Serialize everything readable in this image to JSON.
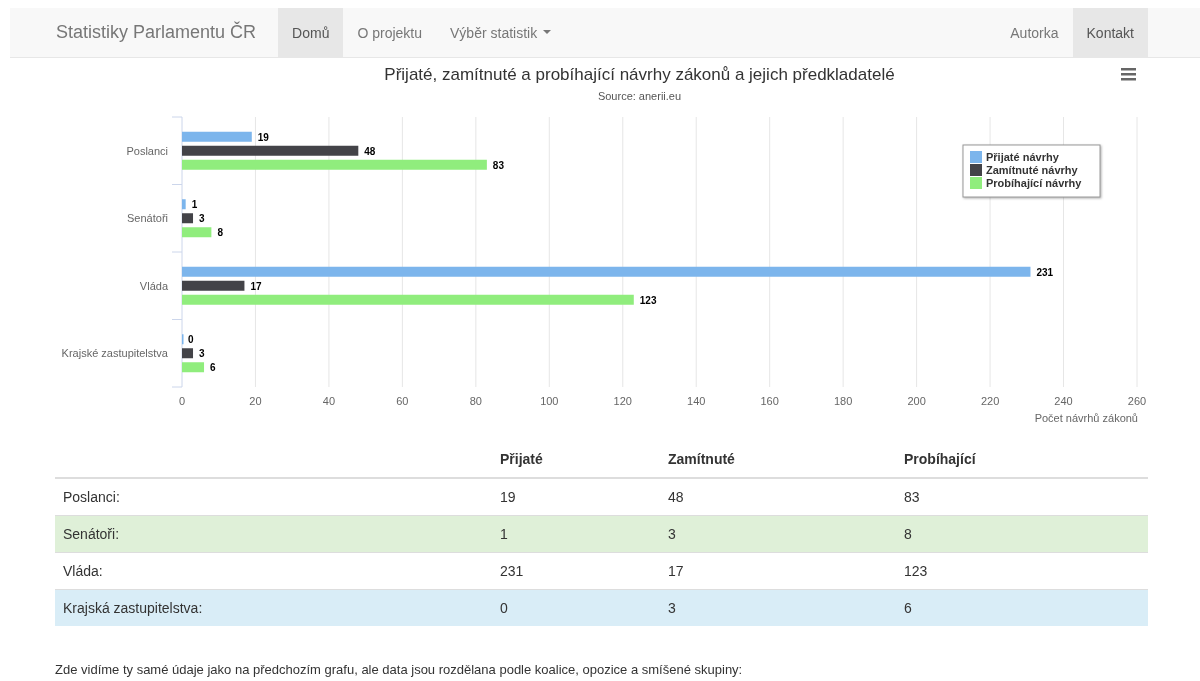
{
  "navbar": {
    "brand": "Statistiky Parlamentu ČR",
    "items": [
      {
        "label": "Domů",
        "selected": true
      },
      {
        "label": "O projektu",
        "selected": false
      },
      {
        "label": "Výběr statistik",
        "selected": false,
        "kind": "dropdown"
      }
    ],
    "right_items": [
      {
        "label": "Autorka",
        "selected": false
      },
      {
        "label": "Kontakt",
        "selected": true
      }
    ]
  },
  "chart": {
    "subtitle": "Source: anerii.eu",
    "chart_data": {
      "type": "bar",
      "orientation": "horizontal",
      "title": "Přijaté, zamítnuté a probíhající návrhy zákonů a jejich předkladatelé",
      "xlabel": "Počet návrhů zákonů",
      "categories": [
        "Poslanci",
        "Senátoři",
        "Vláda",
        "Krajské zastupitelstva"
      ],
      "series": [
        {
          "name": "Přijaté návrhy",
          "color": "#7cb5ec",
          "values": [
            19,
            1,
            231,
            0
          ]
        },
        {
          "name": "Zamítnuté návrhy",
          "color": "#434348",
          "values": [
            48,
            3,
            17,
            3
          ]
        },
        {
          "name": "Probíhající návrhy",
          "color": "#90ed7d",
          "values": [
            83,
            8,
            123,
            6
          ]
        }
      ],
      "xlim": [
        0,
        260
      ],
      "xticks": [
        0,
        20,
        40,
        60,
        80,
        100,
        120,
        140,
        160,
        180,
        200,
        220,
        240,
        260
      ],
      "data_labels": true,
      "legend": true,
      "grid": true
    }
  },
  "table": {
    "columns": [
      "Přijaté",
      "Zamítnuté",
      "Probíhající"
    ],
    "rows": [
      {
        "label": "Poslanci:",
        "cells": [
          "19",
          "48",
          "83"
        ]
      },
      {
        "label": "Senátoři:",
        "cells": [
          "1",
          "3",
          "8"
        ],
        "color": "#dff0d8"
      },
      {
        "label": "Vláda:",
        "cells": [
          "231",
          "17",
          "123"
        ]
      },
      {
        "label": "Krajská zastupitelstva:",
        "cells": [
          "0",
          "3",
          "6"
        ],
        "color": "#d9edf7"
      }
    ]
  },
  "paragraph": "Zde vidíme ty samé údaje jako na předchozím grafu, ale data jsou rozdělana podle koalice, opozice a smíšené skupiny:"
}
